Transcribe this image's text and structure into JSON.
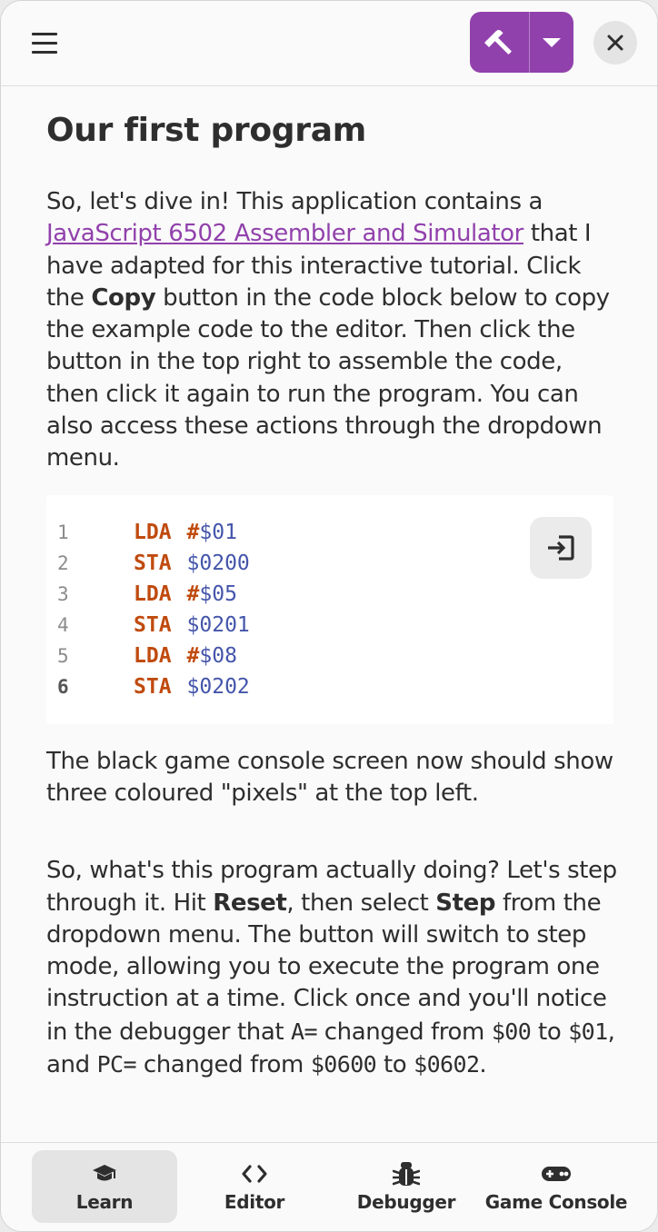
{
  "header": {
    "menu_icon": "hamburger-menu-icon",
    "build_icon": "hammer-icon",
    "dropdown_icon": "chevron-down-icon",
    "close_icon": "close-icon",
    "accent_color": "#9141ac"
  },
  "article": {
    "title": "Our first program",
    "p1": {
      "t1": "So, let's dive in! This application contains a ",
      "link": "JavaScript 6502 Assembler and Simulator",
      "t2": " that I have adapted for this interactive tutorial. Click the ",
      "b1": "Copy",
      "t3": " button in the code block below to copy the example code to the editor. Then click the button in the top right to assemble the code, then click it again to run the program. You can also access these actions through the dropdown menu."
    },
    "code": {
      "lines": [
        {
          "num": "1",
          "op": "LDA",
          "hash": "#",
          "arg": "$01"
        },
        {
          "num": "2",
          "op": "STA",
          "hash": "",
          "arg": "$0200"
        },
        {
          "num": "3",
          "op": "LDA",
          "hash": "#",
          "arg": "$05"
        },
        {
          "num": "4",
          "op": "STA",
          "hash": "",
          "arg": "$0201"
        },
        {
          "num": "5",
          "op": "LDA",
          "hash": "#",
          "arg": "$08"
        },
        {
          "num": "6",
          "op": "STA",
          "hash": "",
          "arg": "$0202"
        }
      ],
      "copy_icon": "copy-to-editor-icon"
    },
    "p2": "The black game console screen now should show three coloured \"pixels\" at the top left.",
    "p3": {
      "t1": "So, what's this program actually doing? Let's step through it. Hit ",
      "b1": "Reset",
      "t2": ", then select ",
      "b2": "Step",
      "t3": " from the dropdown menu. The button will switch to step mode, allowing you to execute the program one instruction at a time. Click once and you'll notice in the debugger that ",
      "c1": "A=",
      "t4": " changed from ",
      "c2": "$00",
      "t5": " to ",
      "c3": "$01",
      "t6": ", and ",
      "c4": "PC=",
      "t7": " changed from ",
      "c5": "$0600",
      "t8": " to ",
      "c6": "$0602",
      "t9": "."
    }
  },
  "nav": {
    "items": [
      {
        "label": "Learn",
        "icon": "graduation-cap-icon",
        "active": true
      },
      {
        "label": "Editor",
        "icon": "code-brackets-icon",
        "active": false
      },
      {
        "label": "Debugger",
        "icon": "bug-icon",
        "active": false
      },
      {
        "label": "Game Console",
        "icon": "gamepad-icon",
        "active": false
      }
    ]
  }
}
